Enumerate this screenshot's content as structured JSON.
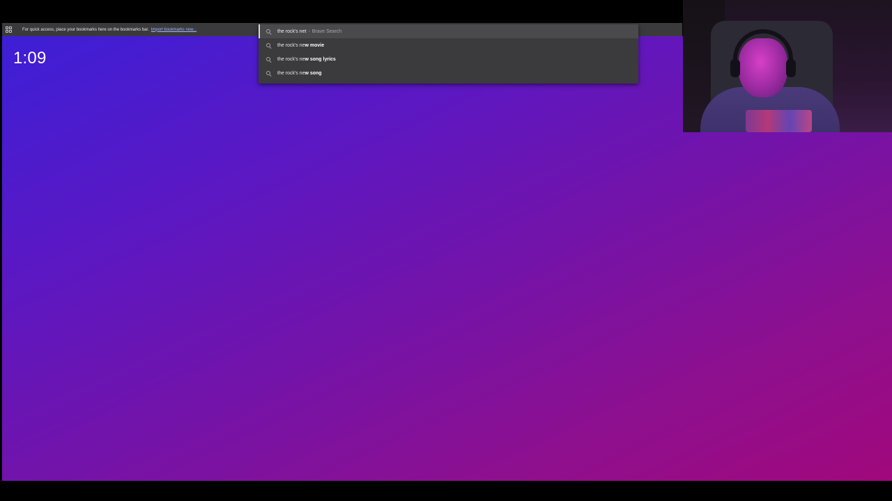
{
  "bookmarks_bar": {
    "message": "For quick access, place your bookmarks here on the bookmarks bar.",
    "import_link": "Import bookmarks now..."
  },
  "newtab": {
    "clock": "1:09",
    "gradient_colors": [
      "#3d1fd6",
      "#5a18c4",
      "#7413a8",
      "#8d108f",
      "#a1087c"
    ]
  },
  "omnibox": {
    "typed_text": "the rock's net",
    "separator": "-",
    "search_engine": "Brave Search",
    "suggestions": [
      {
        "prefix": "the rock's ne",
        "bold": "w movie"
      },
      {
        "prefix": "the rock's ne",
        "bold": "w song lyrics"
      },
      {
        "prefix": "the rock's ne",
        "bold": "w song"
      }
    ]
  },
  "icons": {
    "apps": "apps-grid-icon",
    "search": "search-icon"
  },
  "colors": {
    "toolbar_bg": "#3a3a3c",
    "dropdown_bg": "#3b3b3d",
    "link": "#a9b7ff"
  }
}
